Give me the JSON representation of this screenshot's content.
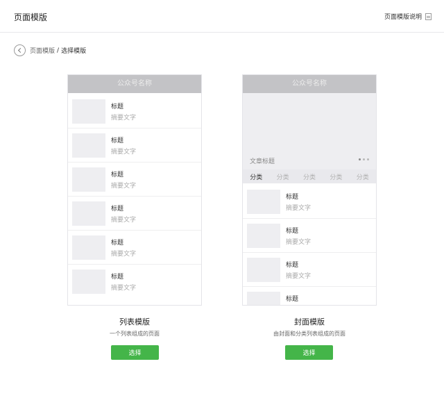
{
  "header": {
    "title": "页面模版",
    "help_label": "页面模版说明"
  },
  "breadcrumb": {
    "parent": "页面模版",
    "separator": "/",
    "current": "选择模版"
  },
  "list_template": {
    "account_name": "公众号名称",
    "items": [
      {
        "title": "标题",
        "desc": "摘要文字"
      },
      {
        "title": "标题",
        "desc": "摘要文字"
      },
      {
        "title": "标题",
        "desc": "摘要文字"
      },
      {
        "title": "标题",
        "desc": "摘要文字"
      },
      {
        "title": "标题",
        "desc": "摘要文字"
      },
      {
        "title": "标题",
        "desc": "摘要文字"
      }
    ],
    "name": "列表模版",
    "description": "一个列表组成的页面",
    "button_label": "选择"
  },
  "cover_template": {
    "account_name": "公众号名称",
    "cover_title": "文章标题",
    "categories": [
      "分类",
      "分类",
      "分类",
      "分类",
      "分类"
    ],
    "items": [
      {
        "title": "标题",
        "desc": "摘要文字"
      },
      {
        "title": "标题",
        "desc": "摘要文字"
      },
      {
        "title": "标题",
        "desc": "摘要文字"
      },
      {
        "title": "标题",
        "desc": ""
      }
    ],
    "name": "封面模版",
    "description": "由封面和分类列表组成的页面",
    "button_label": "选择"
  },
  "colors": {
    "accent": "#44b549",
    "placeholder": "#eeeef1",
    "phone_header": "#c3c3c6"
  },
  "icons": [
    "back-arrow-icon",
    "document-icon"
  ]
}
